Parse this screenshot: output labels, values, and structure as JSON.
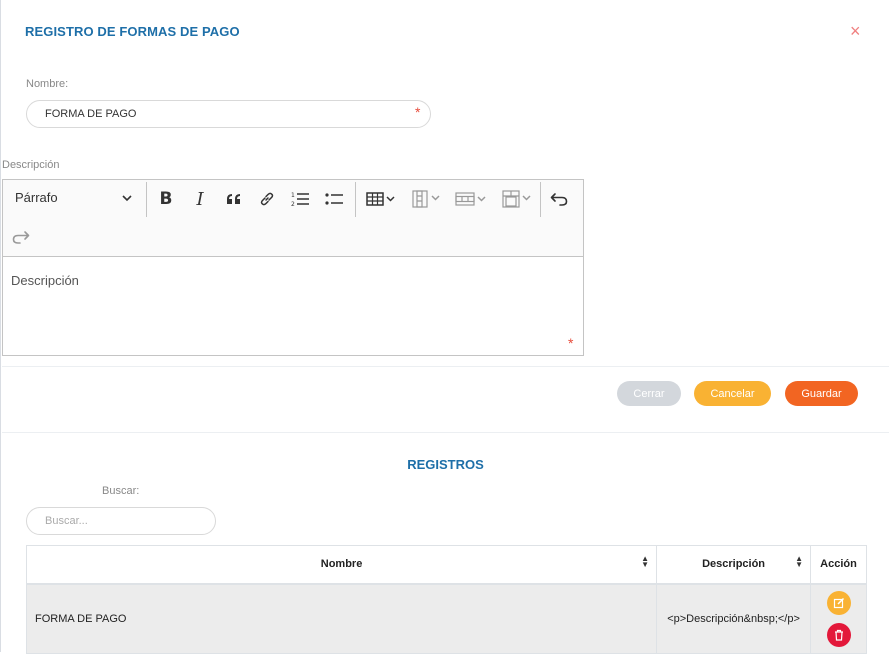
{
  "dialog": {
    "title": "REGISTRO DE FORMAS DE PAGO",
    "close_glyph": "×"
  },
  "form": {
    "name_label": "Nombre:",
    "name_value": "FORMA DE PAGO",
    "required_mark": "*",
    "description_label": "Descripción",
    "editor": {
      "paragraph_style": "Párrafo",
      "content": "Descripción",
      "tools": [
        "bold-icon",
        "italic-icon",
        "blockquote-icon",
        "link-icon",
        "numbered-list-icon",
        "bulleted-list-icon",
        "insert-table-icon",
        "table-column-icon",
        "table-row-icon",
        "merge-cells-icon",
        "undo-icon",
        "redo-icon"
      ]
    }
  },
  "actions": {
    "close_label": "Cerrar",
    "cancel_label": "Cancelar",
    "save_label": "Guardar",
    "colors": {
      "close": "#d3d7dc",
      "cancel": "#f9b233",
      "save": "#f26522"
    }
  },
  "records": {
    "title": "REGISTROS",
    "search_label": "Buscar:",
    "search_placeholder": "Buscar...",
    "columns": [
      "Nombre",
      "Descripción",
      "Acción"
    ],
    "rows": [
      {
        "nombre": "FORMA DE PAGO",
        "descripcion": "<p>Descripción&nbsp;</p>"
      }
    ],
    "action_colors": {
      "edit": "#f9b233",
      "delete": "#e3183a"
    }
  },
  "accent_color": "#1e6fa8"
}
